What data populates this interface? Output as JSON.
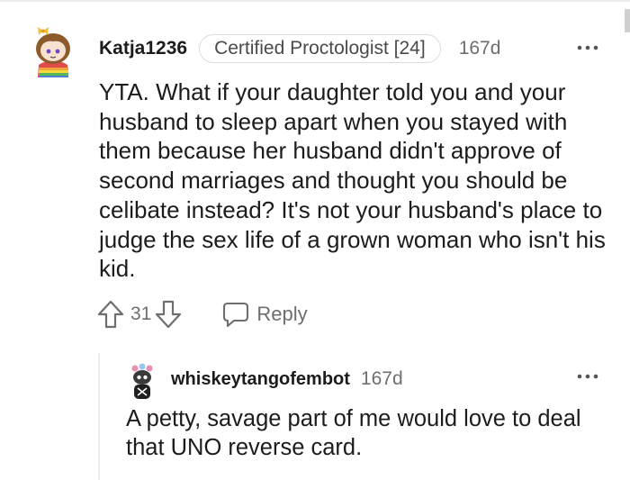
{
  "comment": {
    "avatar_icon": "snoo-avatar-icon",
    "username": "Katja1236",
    "flair": "Certified Proctologist [24]",
    "age": "167d",
    "more_icon": "more-options-icon",
    "body": "YTA. What if your daughter told you and your husband to sleep apart when you stayed with them because her husband didn't approve of second marriages and thought you should be celibate instead? It's not your husband's place to judge the sex life of a grown woman who isn't his kid.",
    "vote_count": "31",
    "upvote_icon": "upvote-arrow-icon",
    "downvote_icon": "downvote-arrow-icon",
    "reply_icon": "reply-bubble-icon",
    "reply_label": "Reply"
  },
  "reply": {
    "avatar_icon": "bot-avatar-icon",
    "username": "whiskeytangofembot",
    "age": "167d",
    "more_icon": "more-options-icon",
    "body": "A petty, savage part of me would love to deal that UNO reverse card."
  },
  "colors": {
    "text": "#1c1c1c",
    "muted": "#6e6e6e",
    "border": "#dcdcdc",
    "background": "#ffffff"
  }
}
